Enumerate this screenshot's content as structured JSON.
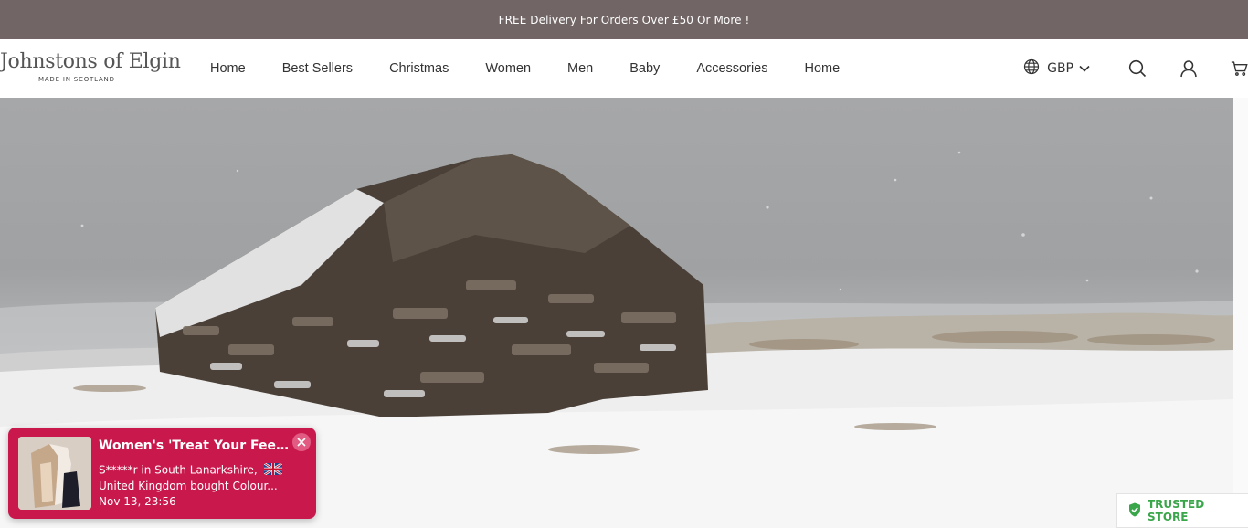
{
  "announcement": {
    "text": "FREE Delivery For Orders Over £50 Or More !"
  },
  "brand": {
    "name": "Johnstons of Elgin",
    "tagline": "MADE IN SCOTLAND"
  },
  "nav": {
    "items": [
      {
        "label": "Home"
      },
      {
        "label": "Best Sellers"
      },
      {
        "label": "Christmas"
      },
      {
        "label": "Women"
      },
      {
        "label": "Men"
      },
      {
        "label": "Baby"
      },
      {
        "label": "Accessories"
      },
      {
        "label": "Home"
      }
    ]
  },
  "tools": {
    "currency": "GBP",
    "icons": [
      "globe-icon",
      "chevron-down-icon",
      "search-icon",
      "account-icon",
      "cart-icon"
    ]
  },
  "toast": {
    "title": "Women's 'Treat Your Feet' C...",
    "line1": "S*****r in South Lanarkshire,",
    "line2": "United Kingdom bought Colour...",
    "time": "Nov 13, 23:56",
    "bg_color": "#c8184c"
  },
  "trust_badge": {
    "label": "TRUSTED STORE",
    "color": "#3aa64a"
  },
  "colors": {
    "announcement_bg": "#726565"
  }
}
